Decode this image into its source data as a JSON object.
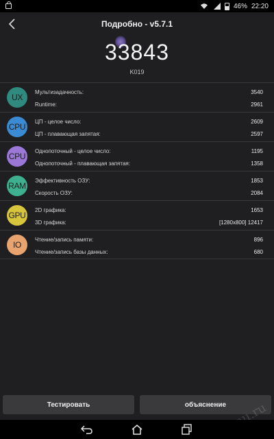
{
  "status_bar": {
    "time": "22:20",
    "battery": "46%"
  },
  "header": {
    "title": "Подробно - v5.7.1"
  },
  "score": {
    "value": "33843",
    "device": "K019"
  },
  "groups": [
    {
      "badge": "UX",
      "color": "#2f8a7f",
      "rows": [
        {
          "label": "Мультизадачность:",
          "value": "3540"
        },
        {
          "label": "Runtime:",
          "value": "2961"
        }
      ]
    },
    {
      "badge": "CPU",
      "color": "#3b8bd4",
      "rows": [
        {
          "label": "ЦП - целое число:",
          "value": "2609"
        },
        {
          "label": "ЦП - плавающая запятая:",
          "value": "2597"
        }
      ]
    },
    {
      "badge": "CPU",
      "color": "#9b78d8",
      "rows": [
        {
          "label": "Однопоточный - целое число:",
          "value": "1195"
        },
        {
          "label": "Однопоточный - плавающая запятая:",
          "value": "1358"
        }
      ]
    },
    {
      "badge": "RAM",
      "color": "#3fb08f",
      "rows": [
        {
          "label": "Эффективность ОЗУ:",
          "value": "1853"
        },
        {
          "label": "Скорость ОЗУ:",
          "value": "2084"
        }
      ]
    },
    {
      "badge": "GPU",
      "color": "#d7c53c",
      "rows": [
        {
          "label": "2D графика:",
          "value": "1653"
        },
        {
          "label": "3D графика:",
          "value": "[1280x800] 12417"
        }
      ]
    },
    {
      "badge": "IO",
      "color": "#e8a36e",
      "rows": [
        {
          "label": "Чтение/запись памяти:",
          "value": "896"
        },
        {
          "label": "Чтение/запись базы данных:",
          "value": "680"
        }
      ]
    }
  ],
  "buttons": {
    "test": "Тестировать",
    "explain": "объяснение"
  },
  "watermark": "24au.ru"
}
